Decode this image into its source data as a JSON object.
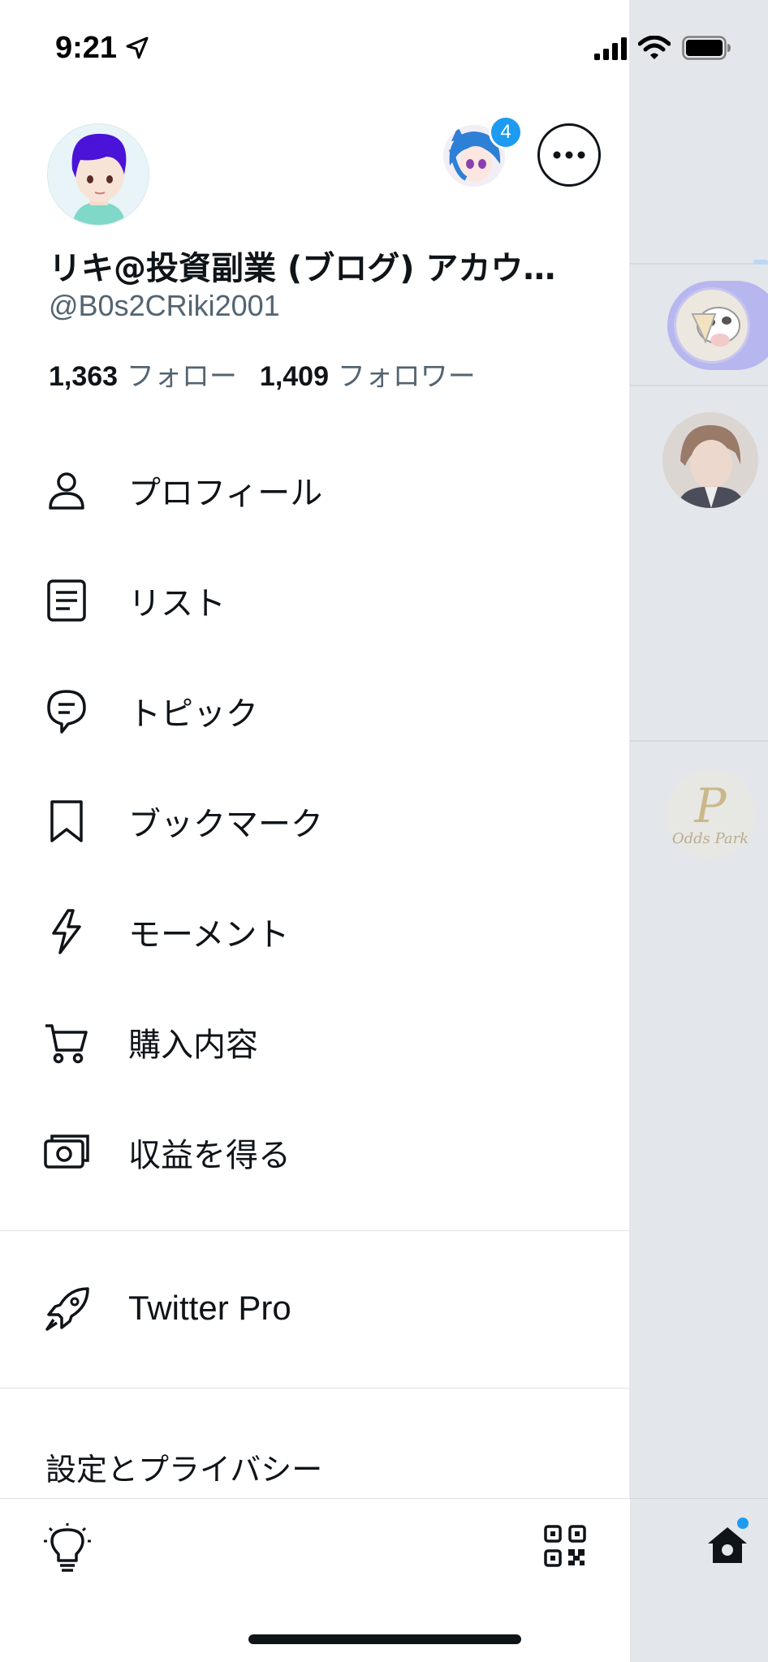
{
  "status_bar": {
    "time": "9:21",
    "icons": [
      "location-arrow-icon",
      "cellular-signal-icon",
      "wifi-icon",
      "battery-icon"
    ]
  },
  "profile": {
    "display_name": "リキ@投資副業 (ブログ) アカウ…",
    "handle": "@B0s2CRiki2001",
    "following_count": "1,363",
    "following_label": "フォロー",
    "followers_count": "1,409",
    "followers_label": "フォロワー",
    "alt_account_badge": "4"
  },
  "menu": {
    "items": [
      {
        "label": "プロフィール",
        "icon": "person-icon"
      },
      {
        "label": "リスト",
        "icon": "list-icon"
      },
      {
        "label": "トピック",
        "icon": "topic-icon"
      },
      {
        "label": "ブックマーク",
        "icon": "bookmark-icon"
      },
      {
        "label": "モーメント",
        "icon": "lightning-icon"
      },
      {
        "label": "購入内容",
        "icon": "cart-icon"
      },
      {
        "label": "収益を得る",
        "icon": "money-icon"
      }
    ],
    "pro_label": "Twitter Pro",
    "settings_label": "設定とプライバシー"
  },
  "background_feed": {
    "logo_letter": "P",
    "logo_text": "Odds Park"
  },
  "colors": {
    "accent": "#1d9bf0",
    "text": "#0f1419",
    "secondary_text": "#536471",
    "feed_overlay": "#e3e6ea"
  }
}
